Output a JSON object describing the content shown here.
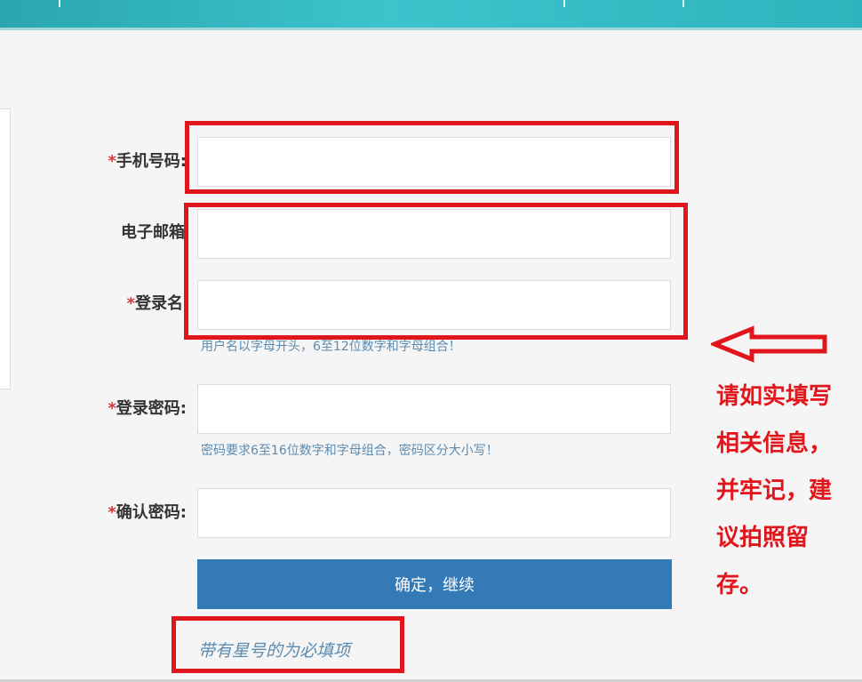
{
  "form": {
    "star": "*",
    "phone": {
      "label": "手机号码:",
      "value": "",
      "placeholder": ""
    },
    "email": {
      "label": "电子邮箱",
      "value": "",
      "placeholder": ""
    },
    "login_name": {
      "label": "登录名",
      "value": "",
      "placeholder": "",
      "hint": "用户名以字母开头，6至12位数字和字母组合！"
    },
    "password": {
      "label": "登录密码:",
      "value": "",
      "placeholder": "",
      "hint": "密码要求6至16位数字和字母组合，密码区分大小写！"
    },
    "confirm_password": {
      "label": "确认密码:",
      "value": "",
      "placeholder": ""
    },
    "submit_label": "确定，继续",
    "required_note": "带有星号的为必填项"
  },
  "annotation": {
    "lines": [
      "请如实填写",
      "相关信息，",
      "并牢记，建",
      "议拍照留",
      "存。"
    ]
  },
  "colors": {
    "header": "#3cc3cc",
    "primary_button": "#337ab7",
    "annotation_red": "#e0161c",
    "required_star": "#d13a3a",
    "hint_text": "#5b8bb0"
  }
}
